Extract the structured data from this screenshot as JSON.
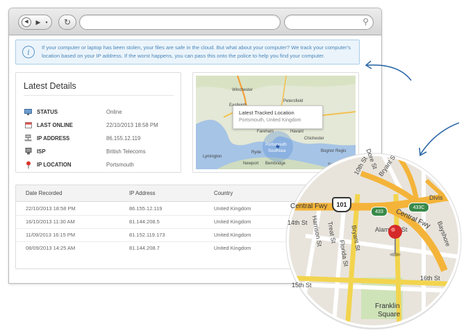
{
  "alert": {
    "icon": "info-icon",
    "text": "If your computer or laptop has been stolen, your files are safe in the cloud. But what about your computer? We track your computer's location based on your IP address.  If the worst happens, you can pass this onto the police to help you find your computer."
  },
  "details": {
    "title": "Latest Details",
    "rows": [
      {
        "label": "STATUS",
        "value": "Online",
        "icon": "monitor-icon"
      },
      {
        "label": "LAST ONLINE",
        "value": "22/10/2013 18:58 PM",
        "icon": "calendar-icon"
      },
      {
        "label": "IP ADDRESS",
        "value": "86.155.12.119",
        "icon": "network-icon"
      },
      {
        "label": "ISP",
        "value": "British Telecoms",
        "icon": "server-icon"
      },
      {
        "label": "IP LOCATION",
        "value": "Portsmouth",
        "icon": "map-pin-icon"
      }
    ]
  },
  "map": {
    "popup_title": "Latest Tracked Location",
    "popup_subtitle": "Portsmouth, United Kingdom",
    "labels": [
      "Winchester",
      "Petersfield",
      "Eastleigh",
      "Fareham",
      "Portsmouth",
      "Southsea",
      "Lymington",
      "Newport",
      "Chichester",
      "Bognor Regis",
      "Selsey",
      "Havant",
      "Ryde",
      "Bembridge"
    ]
  },
  "table": {
    "headers": [
      "Date Recorded",
      "IP Address",
      "Country"
    ],
    "rows": [
      [
        "22/10/2013 18:58 PM",
        "86.155.12.119",
        "United Kingdom"
      ],
      [
        "16/10/2013  11:30 AM",
        "81.144.208.5",
        "United Kingdom"
      ],
      [
        "11/09/2013  16:15 PM",
        "81.152.119.173",
        "United Kingdom"
      ],
      [
        "08/09/2013  14:25 AM",
        "81.144.208.7",
        "United Kingdom"
      ]
    ]
  },
  "zoom_map": {
    "streets": [
      "10th St",
      "Dore St",
      "Bryant S",
      "Divis",
      "Central Fwy",
      "Harrison St",
      "14th St",
      "Treat St",
      "Bryant St",
      "Alameda St",
      "Florida St",
      "Central Fwy",
      "Bayshore",
      "15th St",
      "16th St",
      "Franklin",
      "Square"
    ],
    "shields": [
      "101",
      "433",
      "433C"
    ]
  }
}
